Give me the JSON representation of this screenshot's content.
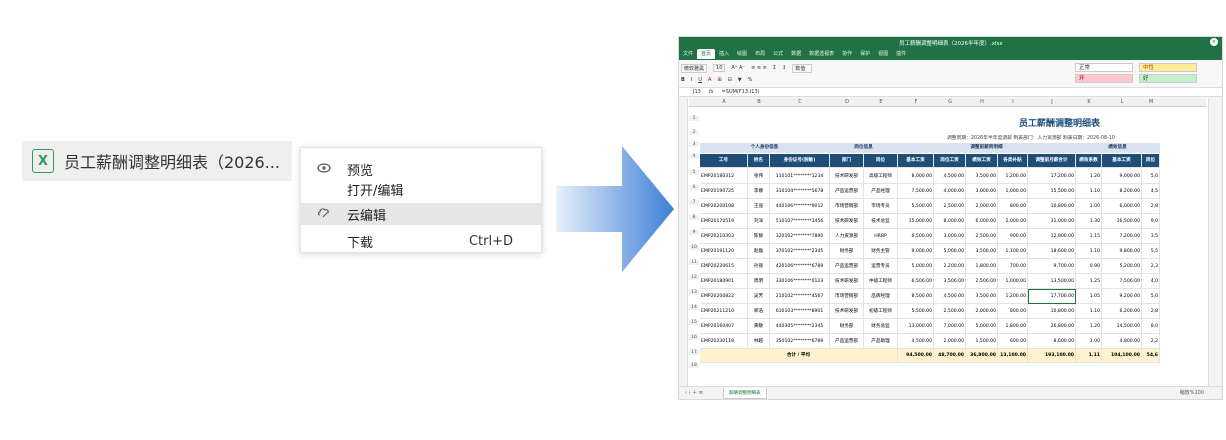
{
  "file": {
    "name": "员工薪酬调整明细表（2026...",
    "icon": "excel-file-icon"
  },
  "menu": [
    {
      "label": "预览",
      "icon": "eye-icon",
      "shortcut": ""
    },
    {
      "label": "打开/编辑",
      "icon": "",
      "shortcut": ""
    },
    {
      "label": "云编辑",
      "icon": "cloud-edit-icon",
      "shortcut": ""
    },
    {
      "label": "下载",
      "icon": "",
      "shortcut": "Ctrl+D"
    }
  ],
  "window": {
    "title": "员工薪酬调整明细表（2026半年度）.xlsx",
    "tabs": [
      "文件",
      "首页",
      "插入",
      "绘图",
      "布局",
      "公式",
      "数据",
      "数据透视表",
      "协作",
      "保护",
      "视图",
      "插件"
    ],
    "font_name": "微软雅黑",
    "font_size": "10",
    "number_format": "数值",
    "style_normal": "正常",
    "style_medium": "中性",
    "style_bad": "坏",
    "style_good": "好",
    "cell_ref": "J13",
    "formula": "=SUM(F13:I13)",
    "sheet_tab": "薪酬调整明细表",
    "zoom": "100%",
    "zoom_label": "缩放%100"
  },
  "sheet": {
    "columns": [
      "A",
      "B",
      "C",
      "D",
      "E",
      "F",
      "G",
      "H",
      "I",
      "J",
      "K",
      "L",
      "M"
    ],
    "title": "员工薪酬调整明细表",
    "subinfo": "调整周期：2026年半年度调薪   制表部门：人力资源部   制表日期：2026-08-10",
    "groups": [
      "个人身份信息",
      "岗位信息",
      "调整前薪资明细",
      "绩效信息"
    ],
    "headers": [
      "工号",
      "姓名",
      "身份证号(脱敏)",
      "部门",
      "岗位",
      "基本工资",
      "岗位工资",
      "绩效工资",
      "各类补贴",
      "调整前月薪合计",
      "绩效系数",
      "基本工资",
      "岗位"
    ],
    "rows": [
      [
        "EMP20180312",
        "张伟",
        "110101********1234",
        "技术研发部",
        "高级工程师",
        "8,000.00",
        "4,500.00",
        "3,500.00",
        "1,200.00",
        "17,200.00",
        "1.20",
        "9,000.00",
        "5,0"
      ],
      [
        "EMP20190725",
        "李娜",
        "310104********5678",
        "产品运营部",
        "产品经理",
        "7,500.00",
        "4,000.00",
        "3,000.00",
        "1,000.00",
        "15,500.00",
        "1.10",
        "8,200.00",
        "4,5"
      ],
      [
        "EMP20200108",
        "王强",
        "440106********9012",
        "市场营销部",
        "市场专员",
        "5,500.00",
        "2,500.00",
        "2,000.00",
        "800.00",
        "10,800.00",
        "1.00",
        "6,000.00",
        "2,8"
      ],
      [
        "EMP20170519",
        "刘洋",
        "510107********3456",
        "技术研发部",
        "技术总监",
        "15,000.00",
        "8,000.00",
        "6,000.00",
        "2,000.00",
        "31,000.00",
        "1.30",
        "16,500.00",
        "9,0"
      ],
      [
        "EMP20210303",
        "陈静",
        "320102********7890",
        "人力资源部",
        "HRBP",
        "6,500.00",
        "3,000.00",
        "2,500.00",
        "900.00",
        "12,900.00",
        "1.15",
        "7,200.00",
        "3,5"
      ],
      [
        "EMP20191120",
        "赵磊",
        "370102********2345",
        "财务部",
        "财务主管",
        "9,000.00",
        "5,000.00",
        "3,500.00",
        "1,100.00",
        "18,600.00",
        "1.10",
        "9,800.00",
        "5,5"
      ],
      [
        "EMP20220615",
        "孙丽",
        "420106********6789",
        "产品运营部",
        "运营专员",
        "5,000.00",
        "2,200.00",
        "1,800.00",
        "700.00",
        "9,700.00",
        "0.90",
        "5,200.00",
        "2,3"
      ],
      [
        "EMP20180901",
        "周明",
        "330106********0123",
        "技术研发部",
        "中级工程师",
        "6,500.00",
        "3,500.00",
        "2,500.00",
        "1,000.00",
        "13,500.00",
        "1.25",
        "7,500.00",
        "4,0"
      ],
      [
        "EMP20200822",
        "吴芳",
        "210102********4567",
        "市场营销部",
        "品牌经理",
        "8,500.00",
        "4,500.00",
        "3,500.00",
        "1,200.00",
        "17,700.00",
        "1.05",
        "9,200.00",
        "5,0"
      ],
      [
        "EMP20211210",
        "郑浩",
        "610103********8901",
        "技术研发部",
        "初级工程师",
        "5,500.00",
        "2,500.00",
        "2,000.00",
        "800.00",
        "10,800.00",
        "1.10",
        "6,200.00",
        "2,8"
      ],
      [
        "EMP20160407",
        "黄敏",
        "440305********2345",
        "财务部",
        "财务总监",
        "13,000.00",
        "7,000.00",
        "5,000.00",
        "1,800.00",
        "26,800.00",
        "1.20",
        "14,500.00",
        "8,0"
      ],
      [
        "EMP20230118",
        "林越",
        "350102********6789",
        "产品运营部",
        "产品助理",
        "4,500.00",
        "2,000.00",
        "1,500.00",
        "600.00",
        "8,600.00",
        "1.00",
        "4,800.00",
        "2,2"
      ]
    ],
    "total_label": "合计 / 平均",
    "totals": [
      "94,500.00",
      "48,700.00",
      "36,800.00",
      "13,100.00",
      "193,100.00",
      "1.11",
      "104,100.00",
      "54,6"
    ],
    "row_numbers": [
      "1",
      "2",
      "3",
      "4",
      "5",
      "6",
      "7",
      "8",
      "9",
      "10",
      "11",
      "12",
      "13",
      "14",
      "15",
      "16",
      "17",
      "18"
    ]
  }
}
